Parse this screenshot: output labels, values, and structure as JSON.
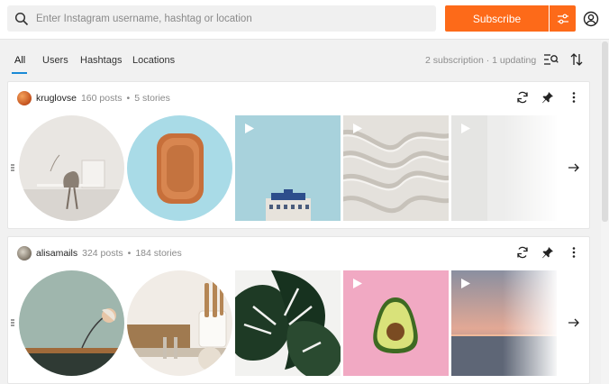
{
  "search": {
    "placeholder": "Enter Instagram username, hashtag or location",
    "value": ""
  },
  "header": {
    "subscribe_label": "Subscribe",
    "accent": "#fd6a19"
  },
  "tabs": [
    {
      "label": "All",
      "active": true
    },
    {
      "label": "Users",
      "active": false
    },
    {
      "label": "Hashtags",
      "active": false
    },
    {
      "label": "Locations",
      "active": false
    }
  ],
  "subscription_info": "2 subscription · 1 updating",
  "subscriptions": [
    {
      "username": "kruglovse",
      "posts": "160 posts",
      "stories": "5 stories",
      "stories_icons": [
        "circle-story",
        "circle-story"
      ],
      "media": [
        "story-desk",
        "story-bowl",
        "post-building-video",
        "post-sand-video",
        "post-white-video"
      ]
    },
    {
      "username": "alisamails",
      "posts": "324 posts",
      "stories": "184 stories",
      "stories_icons": [
        "circle-story",
        "circle-story"
      ],
      "media": [
        "story-lamp",
        "story-kitchen",
        "post-monstera",
        "post-avocado-video",
        "post-sunset-video"
      ]
    }
  ],
  "bullet": "•",
  "icons": [
    "search-icon",
    "filter-icon",
    "account-icon",
    "list-search-icon",
    "sort-icon",
    "refresh-icon",
    "pin-icon",
    "more-icon",
    "arrow-right-icon",
    "drag-handle-icon",
    "play-icon"
  ]
}
